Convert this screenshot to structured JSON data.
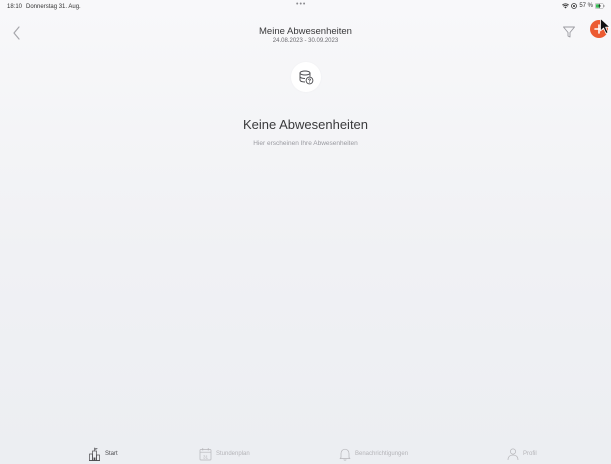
{
  "status_bar": {
    "time": "18:10",
    "date": "Donnerstag 31. Aug.",
    "dots": "•••",
    "battery": "57 %"
  },
  "header": {
    "title": "Meine Abwesenheiten",
    "date_range": "24.08.2023 - 30.09.2023"
  },
  "empty_state": {
    "title": "Keine Abwesenheiten",
    "subtitle": "Hier erscheinen Ihre Abwesenheiten"
  },
  "tabs": [
    {
      "label": "Start",
      "icon": "home-icon",
      "active": true
    },
    {
      "label": "Stundenplan",
      "icon": "calendar-icon",
      "day": "31",
      "active": false
    },
    {
      "label": "Benachrichtigungen",
      "icon": "bell-icon",
      "active": false
    },
    {
      "label": "Profil",
      "icon": "person-icon",
      "active": false
    }
  ],
  "colors": {
    "accent": "#ec5b32",
    "background": "#f3f4f6",
    "inactive_tab": "#b4b4b8"
  }
}
